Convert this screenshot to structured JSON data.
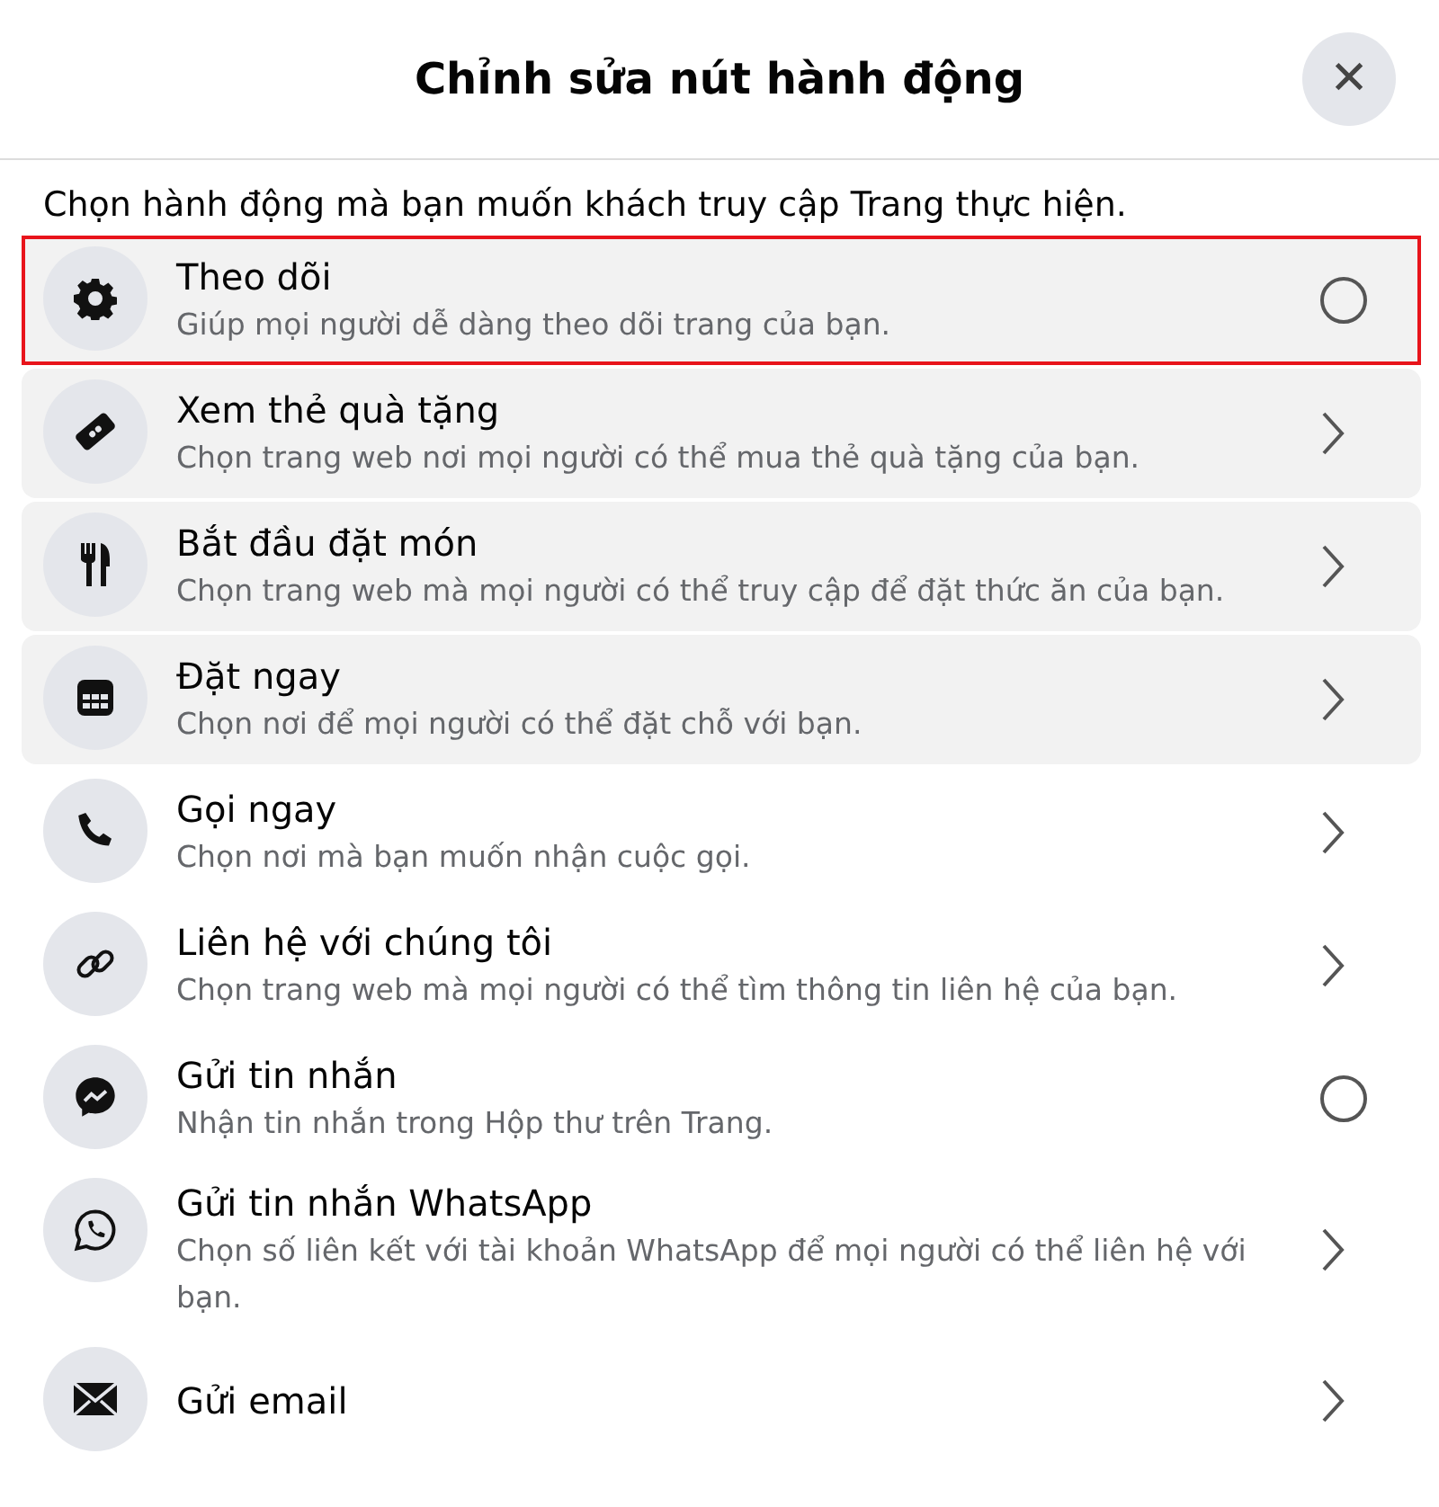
{
  "dialog": {
    "title": "Chỉnh sửa nút hành động",
    "close_label": "✕",
    "intro": "Chọn hành động mà bạn muốn khách truy cập Trang thực hiện."
  },
  "options": [
    {
      "title": "Theo dõi",
      "description": "Giúp mọi người dễ dàng theo dõi trang của bạn.",
      "kind": "radio",
      "shaded": true,
      "outlined": true,
      "selected": false
    },
    {
      "title": "Xem thẻ quà tặng",
      "description": "Chọn trang web nơi mọi người có thể mua thẻ quà tặng của bạn.",
      "kind": "link",
      "shaded": true,
      "outlined": false
    },
    {
      "title": "Bắt đầu đặt món",
      "description": "Chọn trang web mà mọi người có thể truy cập để đặt thức ăn của bạn.",
      "kind": "link",
      "shaded": true,
      "outlined": false
    },
    {
      "title": "Đặt ngay",
      "description": "Chọn nơi để mọi người có thể đặt chỗ với bạn.",
      "kind": "link",
      "shaded": true,
      "outlined": false
    },
    {
      "title": "Gọi ngay",
      "description": "Chọn nơi mà bạn muốn nhận cuộc gọi.",
      "kind": "link",
      "shaded": false,
      "outlined": false
    },
    {
      "title": "Liên hệ với chúng tôi",
      "description": "Chọn trang web mà mọi người có thể tìm thông tin liên hệ của bạn.",
      "kind": "link",
      "shaded": false,
      "outlined": false
    },
    {
      "title": "Gửi tin nhắn",
      "description": "Nhận tin nhắn trong Hộp thư trên Trang.",
      "kind": "radio",
      "shaded": false,
      "outlined": false,
      "selected": false
    },
    {
      "title": "Gửi tin nhắn WhatsApp",
      "description": "Chọn số liên kết với tài khoản WhatsApp để mọi người có thể liên hệ với bạn.",
      "kind": "link",
      "shaded": false,
      "outlined": false
    },
    {
      "title": "Gửi email",
      "kind": "link",
      "shaded": false,
      "outlined": false
    }
  ]
}
